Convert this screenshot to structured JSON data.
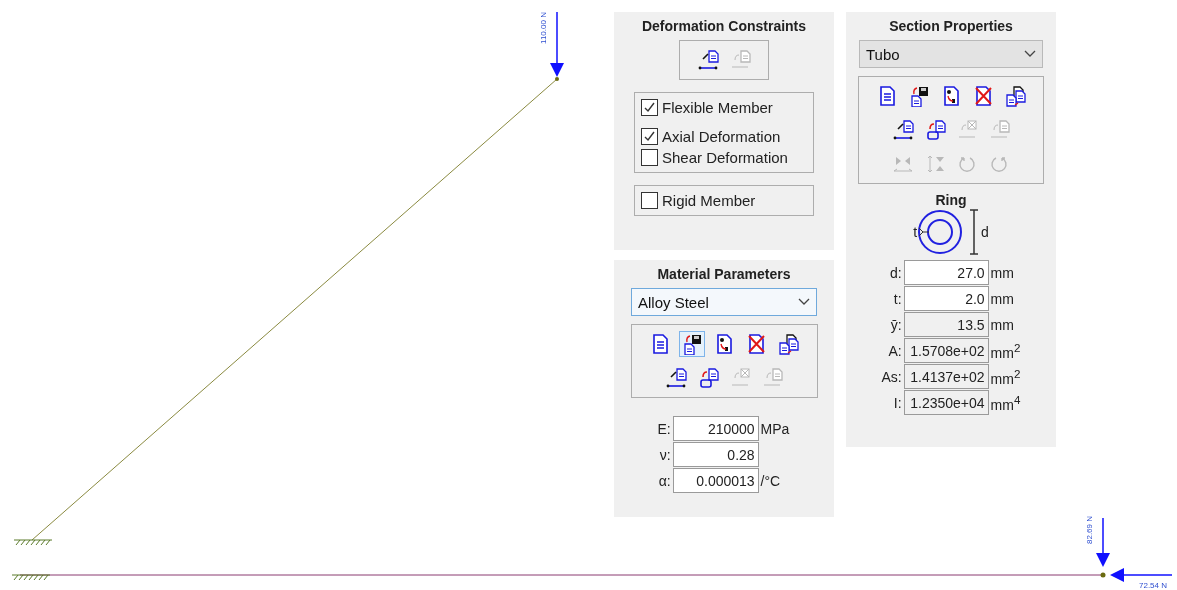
{
  "canvas": {
    "loads": [
      {
        "kind": "down",
        "label": "110.00 N"
      },
      {
        "kind": "down",
        "label": "82.69 N"
      },
      {
        "kind": "left",
        "label": "72.54 N"
      }
    ]
  },
  "deformation": {
    "title": "Deformation Constraints",
    "tools": [
      {
        "disabled": false
      },
      {
        "disabled": true
      }
    ],
    "options": [
      {
        "label": "Flexible Member",
        "checked": true
      },
      {
        "label": "Axial Deformation",
        "checked": true
      },
      {
        "label": "Shear Deformation",
        "checked": false
      }
    ],
    "rigid": {
      "label": "Rigid Member",
      "checked": false
    }
  },
  "material": {
    "title": "Material Parameters",
    "dropdown": "Alloy Steel",
    "tools": [
      [
        {
          "disabled": false,
          "highlighted": false
        },
        {
          "disabled": false,
          "highlighted": true
        },
        {
          "disabled": false,
          "highlighted": false
        },
        {
          "disabled": false,
          "highlighted": false
        },
        {
          "disabled": false,
          "highlighted": false
        }
      ],
      [
        {
          "disabled": false,
          "highlighted": false
        },
        {
          "disabled": false,
          "highlighted": false
        },
        {
          "disabled": true,
          "highlighted": false
        },
        {
          "disabled": true,
          "highlighted": false
        }
      ]
    ],
    "fields": [
      {
        "label": "E:",
        "value": "210000",
        "unit": "MPa"
      },
      {
        "label": "ν:",
        "value": "0.28"
      },
      {
        "label": "α:",
        "value": "0.000013",
        "unit": "/°C"
      }
    ]
  },
  "section": {
    "title": "Section Properties",
    "dropdown": "Tubo",
    "tools": [
      [
        {
          "disabled": false
        },
        {
          "disabled": false
        },
        {
          "disabled": false
        },
        {
          "disabled": false
        },
        {
          "disabled": false
        }
      ],
      [
        {
          "disabled": false
        },
        {
          "disabled": false
        },
        {
          "disabled": true
        },
        {
          "disabled": true
        }
      ],
      [
        {
          "disabled": true
        },
        {
          "disabled": true
        },
        {
          "disabled": true
        },
        {
          "disabled": true
        }
      ]
    ],
    "shape": {
      "title": "Ring",
      "thickness_label": "t",
      "diameter_label": "d"
    },
    "fields": [
      {
        "label": "d:",
        "value": "27.0",
        "unit": "mm",
        "editable": true
      },
      {
        "label": "t:",
        "value": "2.0",
        "unit": "mm",
        "editable": true
      },
      {
        "label": "ȳ:",
        "value": "13.5",
        "unit": "mm",
        "editable": false
      },
      {
        "label": "A:",
        "value": "1.5708e+02",
        "unit": "mm$^{2}$",
        "editable": false
      },
      {
        "label": "As:",
        "value": "1.4137e+02",
        "unit": "mm$^{2}$",
        "editable": false
      },
      {
        "label": "I:",
        "value": "1.2350e+04",
        "unit": "mm$^{4}$",
        "editable": false
      }
    ]
  }
}
